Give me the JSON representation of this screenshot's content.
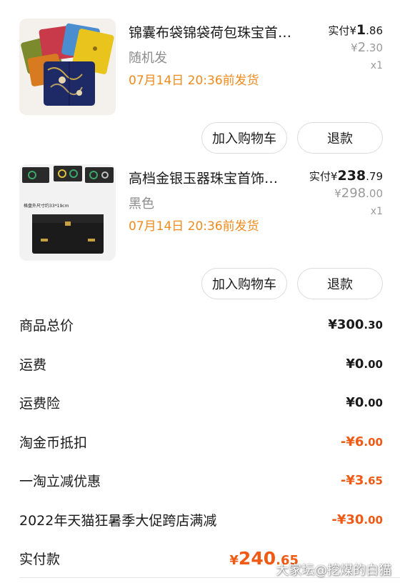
{
  "items": [
    {
      "title": "锦囊布袋锦袋荷包珠宝首…",
      "variant": "随机发",
      "ship_note": "07月14日 20:36前发货",
      "paid_label": "实付",
      "paid_currency": "¥",
      "paid_int": "1",
      "paid_dec": ".86",
      "orig_currency": "¥",
      "orig_int": "2",
      "orig_dec": ".30",
      "qty": "x1",
      "btn_cart": "加入购物车",
      "btn_refund": "退款"
    },
    {
      "title": "高档金银玉器珠宝首饰…",
      "variant": "黑色",
      "ship_note": "07月14日 20:36前发货",
      "paid_label": "实付",
      "paid_currency": "¥",
      "paid_int": "238",
      "paid_dec": ".79",
      "orig_currency": "¥",
      "orig_int": "298",
      "orig_dec": ".00",
      "qty": "x1",
      "btn_cart": "加入购物车",
      "btn_refund": "退款",
      "image_text_size": "格盘外尺寸约33*19cm"
    }
  ],
  "summary": {
    "goods_total_label": "商品总价",
    "goods_total": "¥300",
    "goods_total_dec": ".30",
    "shipping_label": "运费",
    "shipping": "¥0",
    "shipping_dec": ".00",
    "shipping_ins_label": "运费险",
    "shipping_ins": "¥0",
    "shipping_ins_dec": ".00",
    "coin_label": "淘金币抵扣",
    "coin": "-¥6",
    "coin_dec": ".00",
    "instant_label": "一淘立减优惠",
    "instant": "-¥3",
    "instant_dec": ".65",
    "promo_label": "2022年天猫狂暑季大促跨店满减",
    "promo": "-¥30",
    "promo_dec": ".00",
    "paid_label": "实付款",
    "paid_cur": "¥",
    "paid_int": "240",
    "paid_dec": ".65"
  },
  "watermark": "大家坛@挖煤的白猫",
  "colors": {
    "accent": "#f05a14",
    "ship": "#f08a1c",
    "muted": "#9a9a9a"
  }
}
